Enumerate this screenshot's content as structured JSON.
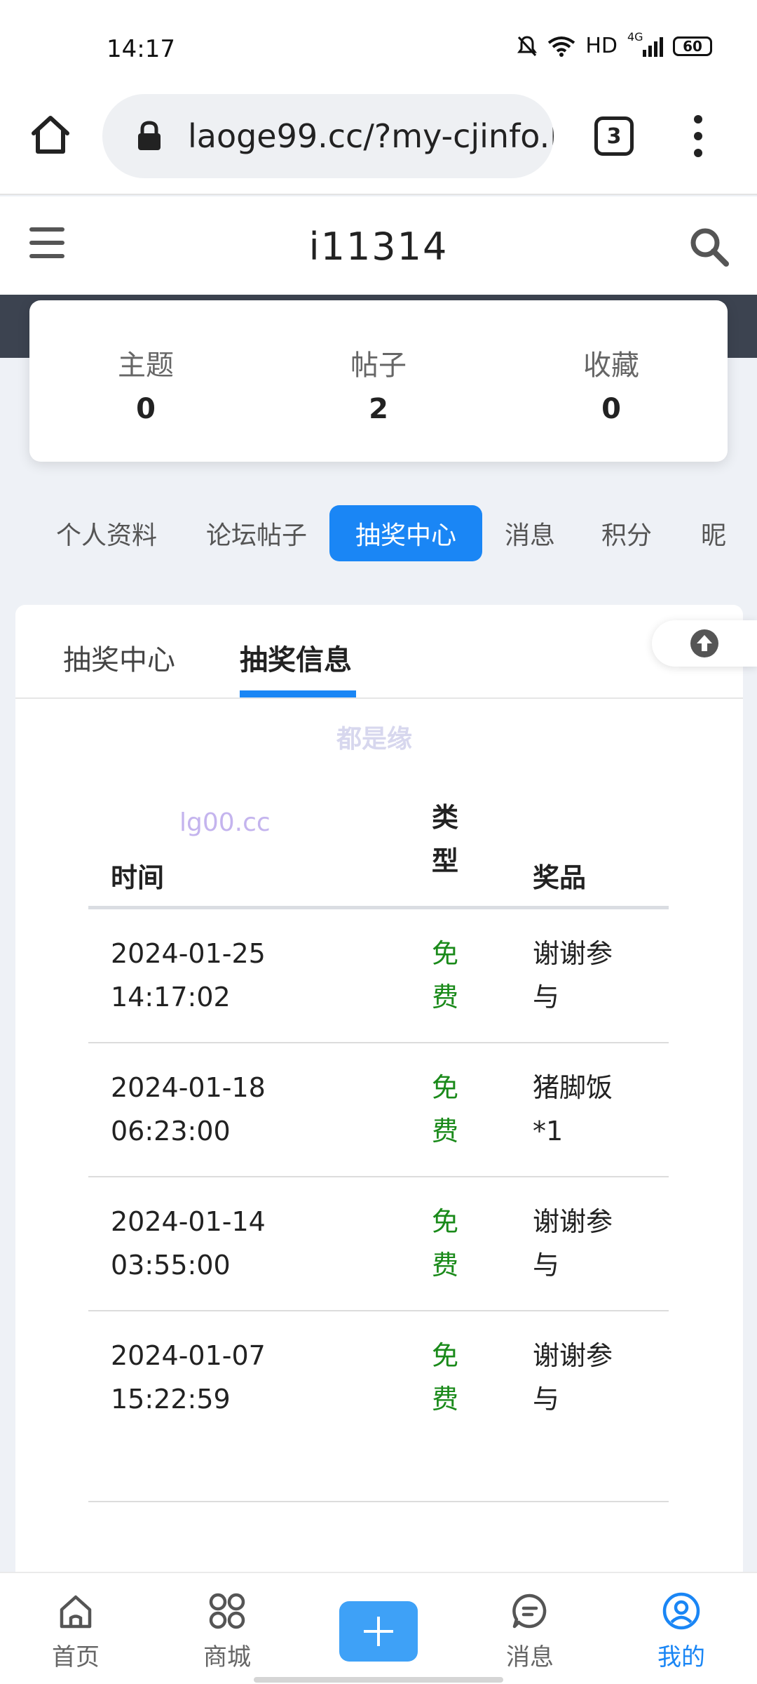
{
  "status_bar": {
    "time": "14:17",
    "network": "HD",
    "signal": "4G",
    "battery": "60"
  },
  "browser": {
    "url": "laoge99.cc/?my-cjinfo.l",
    "tab_count": "3"
  },
  "header": {
    "title": "i11314"
  },
  "stats": [
    {
      "label": "主题",
      "value": "0"
    },
    {
      "label": "帖子",
      "value": "2"
    },
    {
      "label": "收藏",
      "value": "0"
    }
  ],
  "nav_tabs": [
    "个人资料",
    "论坛帖子",
    "抽奖中心",
    "消息",
    "积分",
    "昵"
  ],
  "nav_active": "抽奖中心",
  "sub_tabs": [
    "抽奖中心",
    "抽奖信息"
  ],
  "sub_active": "抽奖信息",
  "watermarks": {
    "top": "都是缘",
    "domain": "lg00.cc"
  },
  "table": {
    "headers": {
      "time": "时间",
      "type": "类型",
      "prize": "奖品"
    },
    "rows": [
      {
        "time": "2024-01-25 14:17:02",
        "type": "免费",
        "prize": "谢谢参与"
      },
      {
        "time": "2024-01-18 06:23:00",
        "type": "免费",
        "prize": "猪脚饭*1"
      },
      {
        "time": "2024-01-14 03:55:00",
        "type": "免费",
        "prize": "谢谢参与"
      },
      {
        "time": "2024-01-07 15:22:59",
        "type": "免费",
        "prize": "谢谢参与"
      }
    ]
  },
  "bottom_nav": [
    {
      "label": "首页",
      "icon": "home-icon"
    },
    {
      "label": "商城",
      "icon": "grid-icon"
    },
    {
      "label": "消息",
      "icon": "chat-icon"
    },
    {
      "label": "我的",
      "icon": "user-icon"
    }
  ],
  "colors": {
    "accent": "#1a86f5",
    "free": "#1a8a1a",
    "plus": "#3ea1f7"
  }
}
